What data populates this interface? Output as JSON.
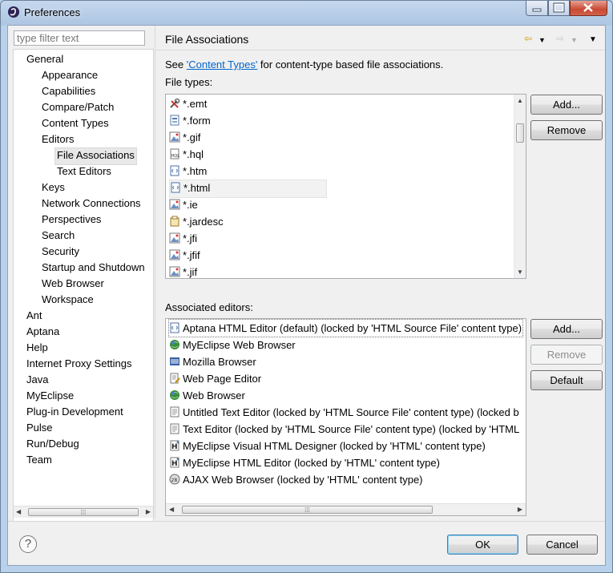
{
  "window": {
    "title": "Preferences"
  },
  "filter": {
    "placeholder": "type filter text"
  },
  "tree": {
    "items": [
      {
        "label": "General",
        "level": 0
      },
      {
        "label": "Appearance",
        "level": 1
      },
      {
        "label": "Capabilities",
        "level": 1
      },
      {
        "label": "Compare/Patch",
        "level": 1
      },
      {
        "label": "Content Types",
        "level": 1
      },
      {
        "label": "Editors",
        "level": 1
      },
      {
        "label": "File Associations",
        "level": 2,
        "selected": true
      },
      {
        "label": "Text Editors",
        "level": 2
      },
      {
        "label": "Keys",
        "level": 1
      },
      {
        "label": "Network Connections",
        "level": 1
      },
      {
        "label": "Perspectives",
        "level": 1
      },
      {
        "label": "Search",
        "level": 1
      },
      {
        "label": "Security",
        "level": 1
      },
      {
        "label": "Startup and Shutdown",
        "level": 1
      },
      {
        "label": "Web Browser",
        "level": 1
      },
      {
        "label": "Workspace",
        "level": 1
      },
      {
        "label": "Ant",
        "level": 0
      },
      {
        "label": "Aptana",
        "level": 0
      },
      {
        "label": "Help",
        "level": 0
      },
      {
        "label": "Internet Proxy Settings",
        "level": 0
      },
      {
        "label": "Java",
        "level": 0
      },
      {
        "label": "MyEclipse",
        "level": 0
      },
      {
        "label": "Plug-in Development",
        "level": 0
      },
      {
        "label": "Pulse",
        "level": 0
      },
      {
        "label": "Run/Debug",
        "level": 0
      },
      {
        "label": "Team",
        "level": 0
      }
    ]
  },
  "page": {
    "title": "File Associations",
    "desc_prefix": "See ",
    "desc_link": "'Content Types'",
    "desc_suffix": " for content-type based file associations.",
    "file_types_label": "File types:",
    "associated_label": "Associated editors:"
  },
  "file_types": [
    {
      "label": "*.emt",
      "icon": "tools-icon"
    },
    {
      "label": "*.form",
      "icon": "form-icon"
    },
    {
      "label": "*.gif",
      "icon": "image-icon"
    },
    {
      "label": "*.hql",
      "icon": "hql-icon"
    },
    {
      "label": "*.htm",
      "icon": "html-icon"
    },
    {
      "label": "*.html",
      "icon": "html-icon",
      "selected": true
    },
    {
      "label": "*.ie",
      "icon": "image-icon"
    },
    {
      "label": "*.jardesc",
      "icon": "jar-icon"
    },
    {
      "label": "*.jfi",
      "icon": "image-icon"
    },
    {
      "label": "*.jfif",
      "icon": "image-icon"
    },
    {
      "label": "*.jif",
      "icon": "image-icon"
    }
  ],
  "editors": [
    {
      "label": "Aptana HTML Editor (default) (locked by 'HTML Source File' content type)",
      "icon": "html-icon",
      "selected": true
    },
    {
      "label": "MyEclipse Web Browser",
      "icon": "globe-icon"
    },
    {
      "label": "Mozilla Browser",
      "icon": "mozilla-icon"
    },
    {
      "label": "Web Page Editor",
      "icon": "page-editor-icon"
    },
    {
      "label": "Web Browser",
      "icon": "globe-icon"
    },
    {
      "label": "Untitled Text Editor (locked by 'HTML Source File' content type) (locked b",
      "icon": "text-file-icon"
    },
    {
      "label": "Text Editor (locked by 'HTML Source File' content type) (locked by 'HTML",
      "icon": "text-file-icon"
    },
    {
      "label": "MyEclipse Visual HTML Designer (locked by 'HTML' content type)",
      "icon": "html-designer-icon"
    },
    {
      "label": "MyEclipse HTML Editor (locked by 'HTML' content type)",
      "icon": "html-designer-icon"
    },
    {
      "label": "AJAX Web Browser (locked by 'HTML' content type)",
      "icon": "ajax-icon"
    }
  ],
  "buttons": {
    "add_types": "Add...",
    "remove_types": "Remove",
    "add_editor": "Add...",
    "remove_editor": "Remove",
    "default_editor": "Default",
    "ok": "OK",
    "cancel": "Cancel"
  },
  "colors": {
    "link": "#0066cc",
    "default_button_border": "#3c7fb1"
  }
}
